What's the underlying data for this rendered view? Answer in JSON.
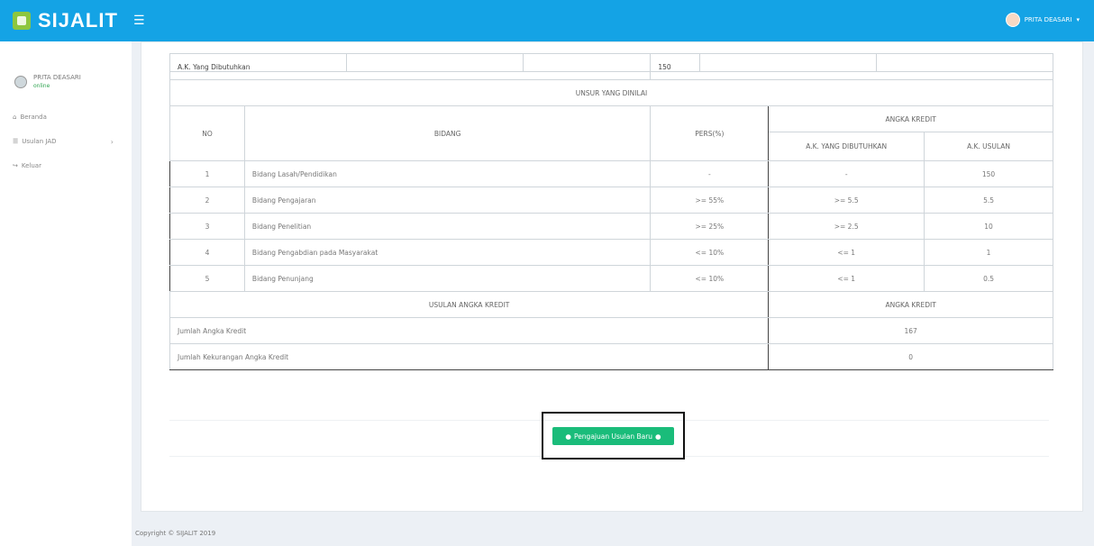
{
  "brand": {
    "name": "SIJALIT"
  },
  "topbar": {
    "user_name": "PRITA DEASARI"
  },
  "sidebar": {
    "user_name": "PRITA DEASARI",
    "status": "online",
    "items": [
      {
        "label": "Beranda",
        "icon": "home-icon"
      },
      {
        "label": "Usulan JAD",
        "icon": "list-icon",
        "has_children": true
      },
      {
        "label": "Keluar",
        "icon": "logout-icon"
      }
    ]
  },
  "table": {
    "ak_label": "A.K. Yang Dibutuhkan",
    "ak_value": "150",
    "section_title": "UNSUR YANG DINILAI",
    "headers": {
      "no": "NO",
      "bidang": "BIDANG",
      "pers": "PERS(%)",
      "angka_kredit": "ANGKA KREDIT",
      "ak_dibutuhkan": "A.K. YANG DIBUTUHKAN",
      "ak_usulan": "A.K. USULAN"
    },
    "rows": [
      {
        "no": "1",
        "bidang": "Bidang Lasah/Pendidikan",
        "pers": "-",
        "ak_dibutuhkan": "-",
        "ak_usulan": "150"
      },
      {
        "no": "2",
        "bidang": "Bidang Pengajaran",
        "pers": ">= 55%",
        "ak_dibutuhkan": ">= 5.5",
        "ak_usulan": "5.5"
      },
      {
        "no": "3",
        "bidang": "Bidang Penelitian",
        "pers": ">= 25%",
        "ak_dibutuhkan": ">= 2.5",
        "ak_usulan": "10"
      },
      {
        "no": "4",
        "bidang": "Bidang Pengabdian pada Masyarakat",
        "pers": "<= 10%",
        "ak_dibutuhkan": "<= 1",
        "ak_usulan": "1"
      },
      {
        "no": "5",
        "bidang": "Bidang Penunjang",
        "pers": "<= 10%",
        "ak_dibutuhkan": "<= 1",
        "ak_usulan": "0.5"
      }
    ],
    "summary_title": "USULAN ANGKA KREDIT",
    "summary_col": "ANGKA KREDIT",
    "summary_rows": [
      {
        "label": "Jumlah Angka Kredit",
        "value": "167"
      },
      {
        "label": "Jumlah Kekurangan Angka Kredit",
        "value": "0"
      }
    ]
  },
  "action": {
    "button_label": "Pengajuan Usulan Baru"
  },
  "footer": {
    "text": "Copyright © SIJALIT 2019"
  },
  "colors": {
    "topbar": "#14a3e5",
    "button": "#1abc7a",
    "online": "#2ea44f"
  }
}
